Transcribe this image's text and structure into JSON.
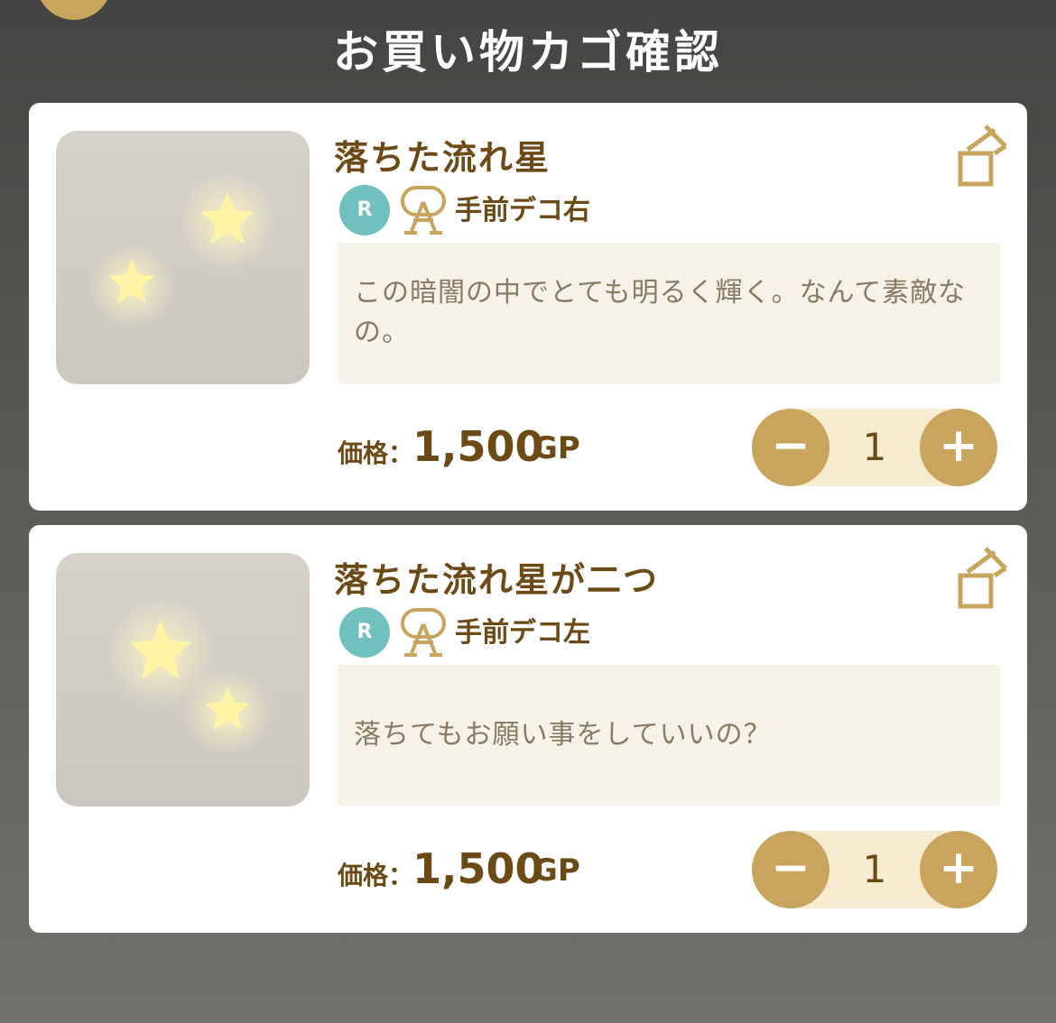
{
  "header": {
    "title": "お買い物カゴ確認"
  },
  "colors": {
    "gold": "#c9a45c",
    "brown_text": "#6b4a16",
    "rarity_teal": "#6fc0be",
    "desc_bg": "#f7f2e8",
    "stepper_bg": "#f7eccf"
  },
  "cart": {
    "items": [
      {
        "name": "落ちた流れ星",
        "rarity": "R",
        "type_icon": "stand-icon",
        "position": "手前デコ右",
        "description": "この暗闇の中でとても明るく輝く。なんて素敵なの。",
        "price_label": "価格：",
        "price": "1,500",
        "currency": "GP",
        "quantity": "1",
        "minus_label": "−",
        "plus_label": "+"
      },
      {
        "name": "落ちた流れ星が二つ",
        "rarity": "R",
        "type_icon": "stand-icon",
        "position": "手前デコ左",
        "description": "落ちてもお願い事をしていいの？",
        "price_label": "価格：",
        "price": "1,500",
        "currency": "GP",
        "quantity": "1",
        "minus_label": "−",
        "plus_label": "+"
      }
    ]
  }
}
